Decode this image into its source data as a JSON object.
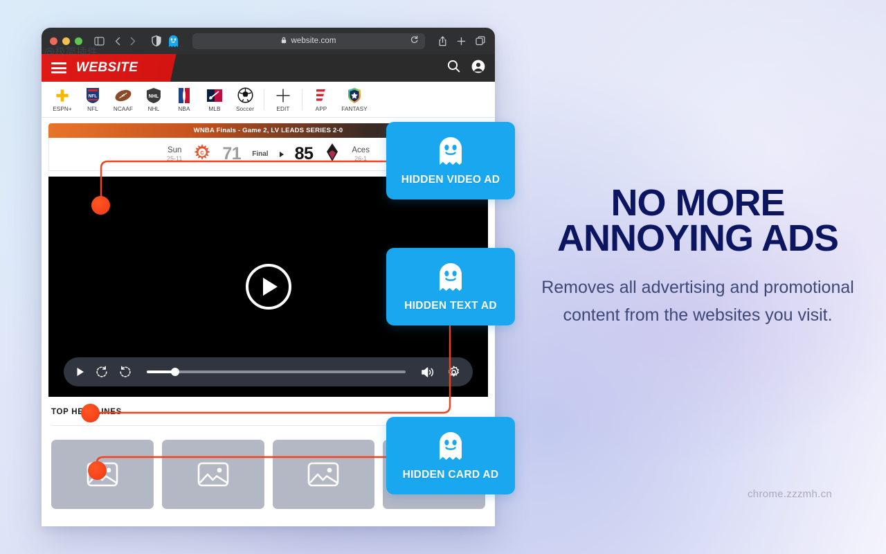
{
  "watermarks": {
    "top_left": "@极简插件",
    "bottom_right": "chrome.zzzmh.cn"
  },
  "colors": {
    "badge_blue": "#19a8ef",
    "brand_red": "#e01a17",
    "annotation_red": "#f4411b",
    "headline_navy": "#0b1560",
    "subtitle_blue": "#3e4878"
  },
  "browser": {
    "traffic_lights": [
      "close",
      "minimize",
      "maximize"
    ],
    "toolbar_left_icons": [
      "sidebar-icon",
      "back-icon",
      "forward-icon"
    ],
    "toolbar_mid_icons": [
      "shield-icon",
      "ghostery-extension-icon"
    ],
    "url": "website.com",
    "url_lock_icon": "lock-icon",
    "reload_icon": "reload-icon",
    "toolbar_right_icons": [
      "share-icon",
      "new-tab-icon",
      "tab-overview-icon"
    ]
  },
  "site": {
    "brand": "WEBSITE",
    "menu_icon": "hamburger-icon",
    "header_icons": [
      "search-icon",
      "account-icon"
    ],
    "nav": [
      {
        "label": "ESPN+",
        "icon": "espn-plus-icon"
      },
      {
        "label": "NFL",
        "icon": "nfl-icon"
      },
      {
        "label": "NCAAF",
        "icon": "ncaaf-football-icon"
      },
      {
        "label": "NHL",
        "icon": "nhl-icon"
      },
      {
        "label": "NBA",
        "icon": "nba-icon"
      },
      {
        "label": "MLB",
        "icon": "mlb-icon"
      },
      {
        "label": "Soccer",
        "icon": "soccer-ball-icon"
      },
      {
        "label": "EDIT",
        "icon": "plus-icon"
      },
      {
        "label": "APP",
        "icon": "espn-app-icon"
      },
      {
        "label": "FANTASY",
        "icon": "fantasy-shield-icon"
      }
    ],
    "scorebar": {
      "banner": "WNBA Finals - Game 2, LV LEADS SERIES 2-0",
      "away_team": "Sun",
      "away_record": "25-11",
      "away_score": "71",
      "status": "Final",
      "home_score": "85",
      "home_team": "Aces",
      "home_record": "26-1"
    },
    "video": {
      "play_icon": "play-button-icon",
      "controls": {
        "play": "play-icon",
        "rewind": "rewind-10-icon",
        "forward": "forward-10-icon",
        "progress_percent": "11",
        "volume": "volume-icon",
        "settings": "gear-icon"
      }
    },
    "headlines": {
      "title": "TOP HEADLINES",
      "cards": [
        {
          "icon": "image-placeholder-icon"
        },
        {
          "icon": "image-placeholder-icon"
        },
        {
          "icon": "image-placeholder-icon"
        },
        {
          "icon": "image-placeholder-icon"
        }
      ]
    }
  },
  "badges": [
    {
      "label": "HIDDEN VIDEO AD",
      "icon": "ghost-icon"
    },
    {
      "label": "HIDDEN TEXT AD",
      "icon": "ghost-icon"
    },
    {
      "label": "HIDDEN CARD AD",
      "icon": "ghost-icon"
    }
  ],
  "promo": {
    "headline_line1": "NO MORE",
    "headline_line2": "ANNOYING ADS",
    "subtitle": "Removes all advertising and promotional content from the websites you visit."
  }
}
